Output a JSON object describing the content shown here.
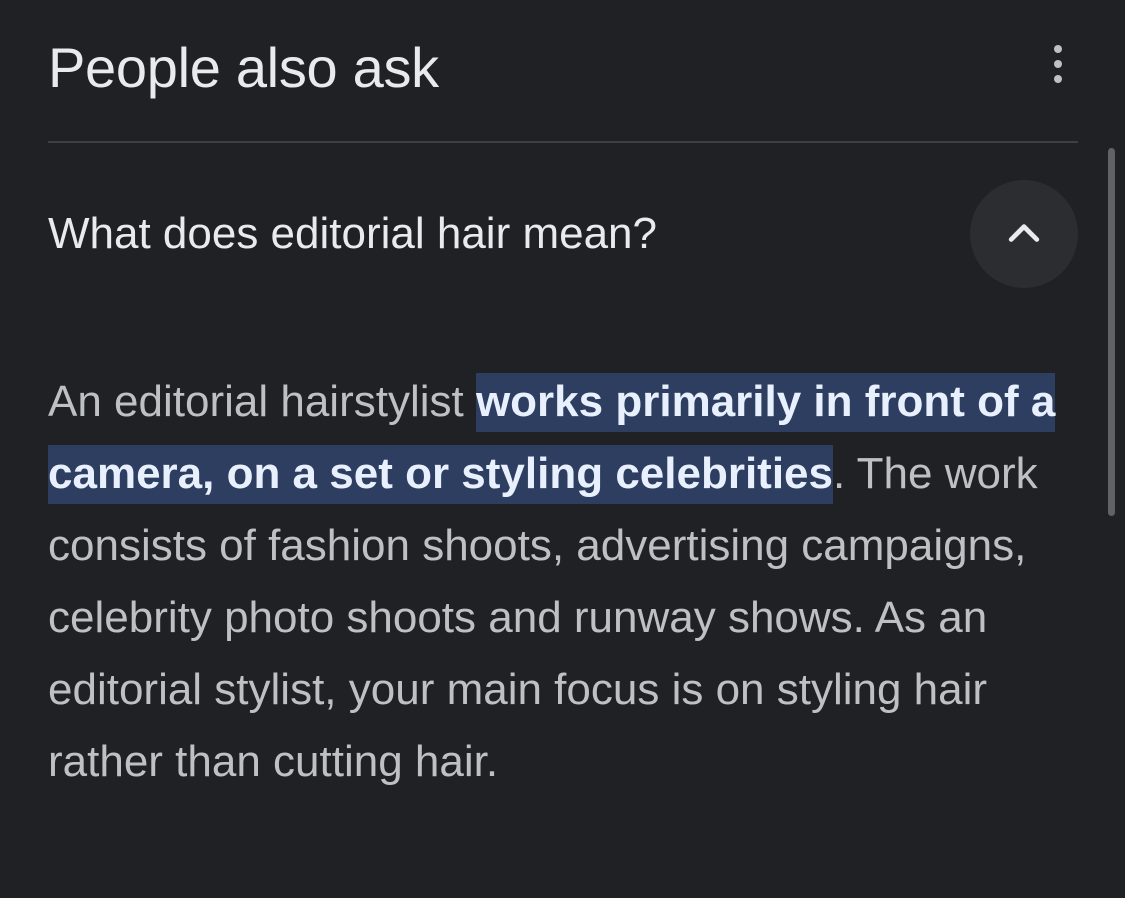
{
  "header": {
    "title": "People also ask",
    "more_icon": "more-vert-icon"
  },
  "question": {
    "text": "What does editorial hair mean?",
    "toggle_icon": "chevron-up-icon",
    "expanded": true
  },
  "answer": {
    "prefix": "An editorial hairstylist ",
    "highlight": "works primarily in front of a camera, on a set or styling celebrities",
    "suffix": ". The work consists of fashion shoots, advertising campaigns, celebrity photo shoots and runway shows. As an editorial stylist, your main focus is on styling hair rather than cutting hair."
  },
  "colors": {
    "background": "#202124",
    "title_text": "#e8eaed",
    "body_text": "#bdc1c6",
    "highlight_background": "#2e3e60",
    "highlight_text": "#e8f0fe",
    "divider": "#3c4043",
    "toggle_background": "#2c2d30"
  }
}
